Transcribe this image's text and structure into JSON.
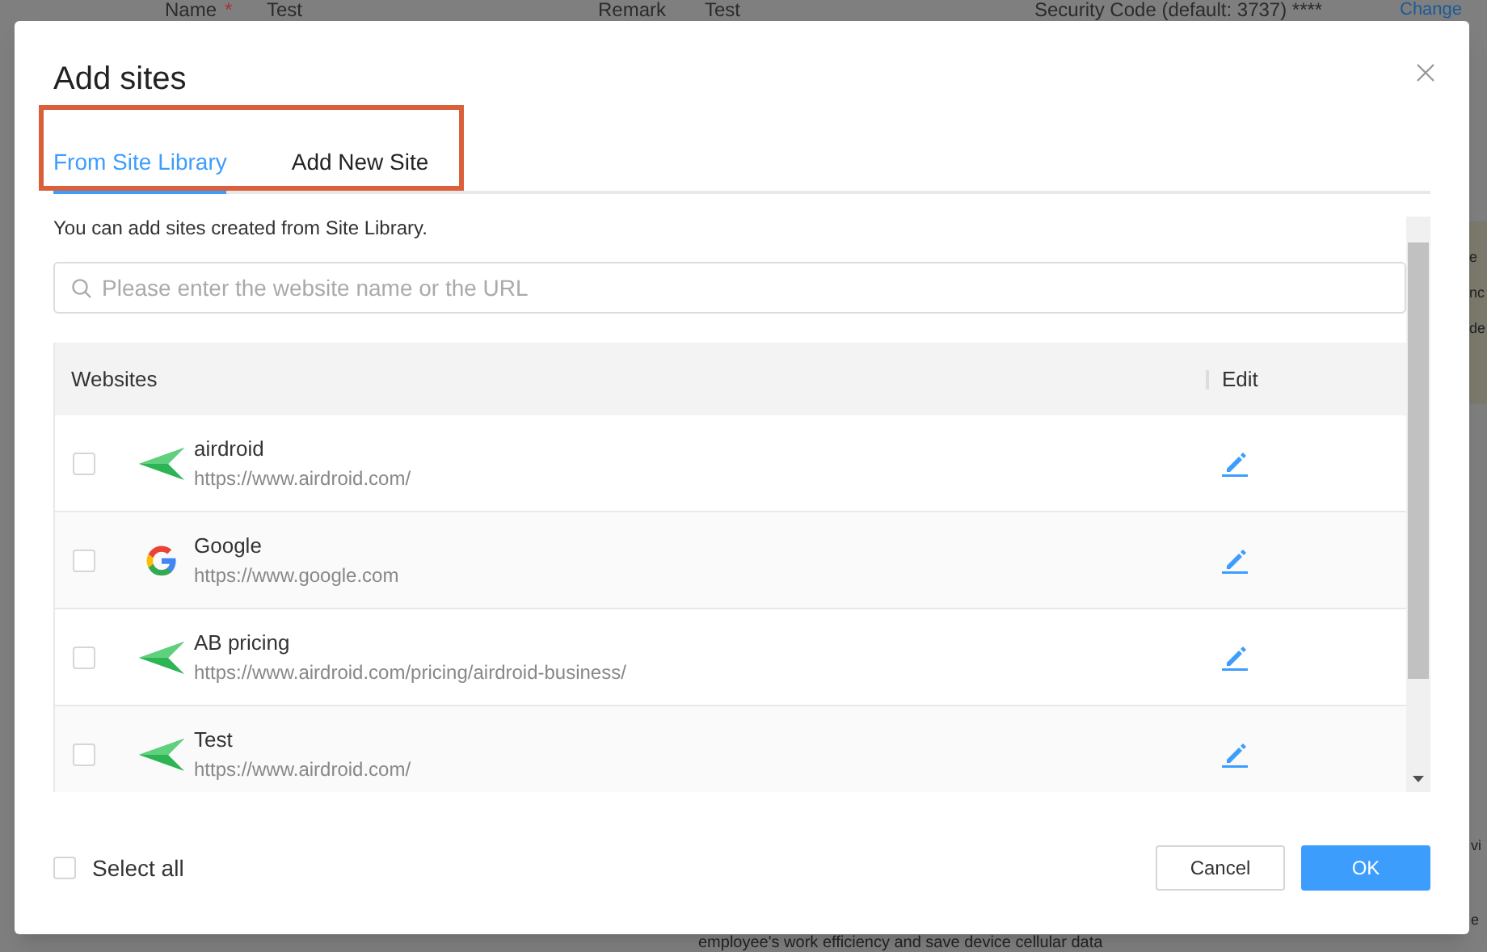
{
  "background": {
    "name_label": "Name",
    "required_mark": "*",
    "name_value": "Test",
    "remark_label": "Remark",
    "remark_value": "Test",
    "security_code": "Security Code (default: 3737) ****",
    "change_link": "Change",
    "notice_lines": [
      "e",
      "nc",
      "de"
    ],
    "side_lines": [
      "vi",
      "e"
    ],
    "bottom_text": "employee's work efficiency and save device cellular data"
  },
  "dialog": {
    "title": "Add sites",
    "tabs": [
      {
        "label": "From Site Library",
        "selected": true
      },
      {
        "label": "Add New Site",
        "selected": false
      }
    ],
    "hint": "You can add sites created from Site Library.",
    "search": {
      "placeholder": "Please enter the website name or the URL"
    },
    "columns": [
      "Websites",
      "Edit"
    ],
    "rows": [
      {
        "name": "airdroid",
        "url": "https://www.airdroid.com/",
        "kind": "airdroid",
        "checked": false
      },
      {
        "name": "Google",
        "url": "https://www.google.com",
        "kind": "google",
        "checked": false
      },
      {
        "name": "AB pricing",
        "url": "https://www.airdroid.com/pricing/airdroid-business/",
        "kind": "airdroid",
        "checked": false
      },
      {
        "name": "Test",
        "url": "https://www.airdroid.com/",
        "kind": "airdroid",
        "checked": false
      }
    ],
    "select_all": {
      "label": "Select all",
      "checked": false
    },
    "buttons": [
      {
        "label": "Cancel",
        "kind": "secondary"
      },
      {
        "label": "OK",
        "kind": "primary"
      }
    ]
  }
}
